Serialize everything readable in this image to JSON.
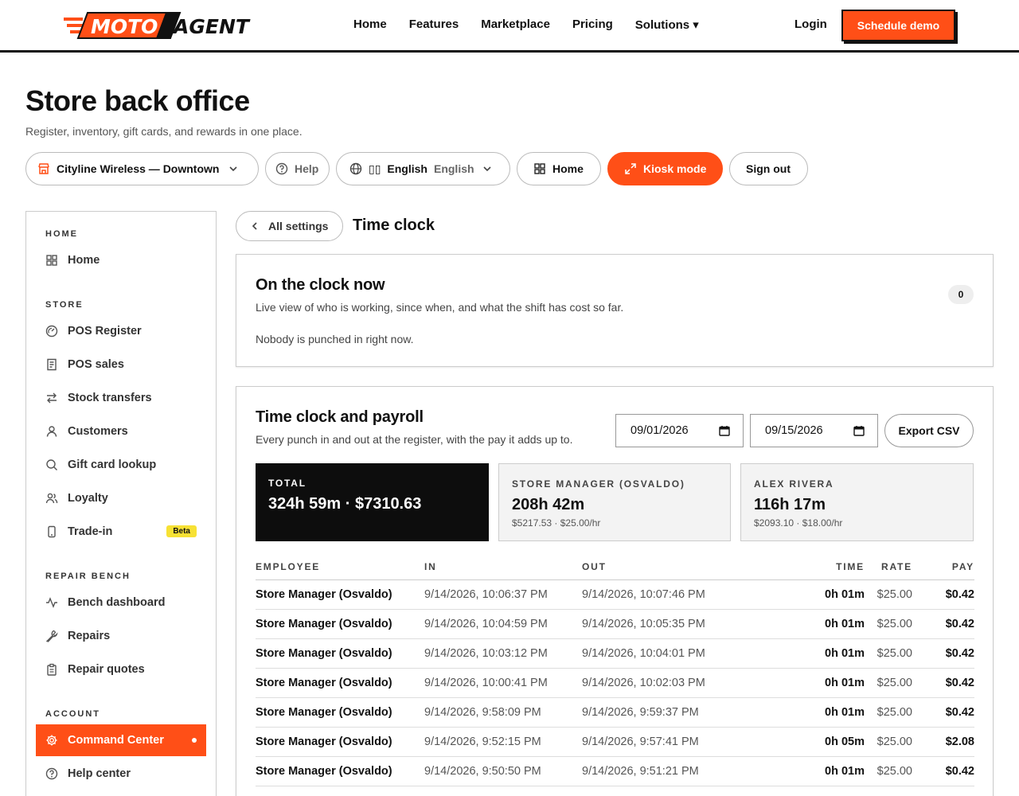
{
  "nav": {
    "brand_left": "MOTO",
    "brand_right": "AGENT",
    "links": [
      "Home",
      "Features",
      "Marketplace",
      "Pricing",
      "Solutions ▾"
    ],
    "login": "Login",
    "cta": "Schedule demo"
  },
  "header": {
    "title": "Store back office",
    "subtitle": "Register, inventory, gift cards, and rewards in one place."
  },
  "toolbar": {
    "store": "Cityline Wireless — Downtown",
    "help": "Help",
    "lang_flag": "▯▯",
    "lang_native": "English",
    "lang_en": "English",
    "home": "Home",
    "kiosk": "Kiosk mode",
    "signout": "Sign out"
  },
  "sidebar": {
    "sections": [
      "HOME",
      "STORE",
      "REPAIR BENCH",
      "ACCOUNT"
    ],
    "items": [
      {
        "label": "Home",
        "icon": "grid-icon"
      },
      {
        "label": "POS Register",
        "icon": "gauge-icon"
      },
      {
        "label": "POS sales",
        "icon": "receipt-icon"
      },
      {
        "label": "Stock transfers",
        "icon": "arrows-swap-icon"
      },
      {
        "label": "Customers",
        "icon": "user-icon"
      },
      {
        "label": "Gift card lookup",
        "icon": "search-icon"
      },
      {
        "label": "Loyalty",
        "icon": "users-icon"
      },
      {
        "label": "Trade-in",
        "icon": "phone-icon"
      },
      {
        "label": "Bench dashboard",
        "icon": "pulse-icon"
      },
      {
        "label": "Repairs",
        "icon": "wrench-icon"
      },
      {
        "label": "Repair quotes",
        "icon": "clipboard-icon"
      },
      {
        "label": "Command Center",
        "icon": "gear-icon"
      },
      {
        "label": "Help center",
        "icon": "help-circle-icon"
      }
    ],
    "beta": "Beta"
  },
  "main": {
    "back": "All settings",
    "title": "Time clock"
  },
  "on_clock": {
    "title": "On the clock now",
    "description": "Live view of who is working, since when, and what the shift has cost so far.",
    "empty": "Nobody is punched in right now.",
    "count": "0"
  },
  "payroll": {
    "title": "Time clock and payroll",
    "description": "Every punch in and out at the register, with the pay it adds up to.",
    "from_date": "09/01/2026",
    "to_date": "09/15/2026",
    "export": "Export CSV",
    "stats": [
      {
        "label": "TOTAL",
        "value": "324h 59m · $7310.63",
        "sub": ""
      },
      {
        "label": "STORE MANAGER (OSVALDO)",
        "value": "208h 42m",
        "sub": "$5217.53 · $25.00/hr"
      },
      {
        "label": "ALEX RIVERA",
        "value": "116h 17m",
        "sub": "$2093.10 · $18.00/hr"
      }
    ],
    "columns": [
      "EMPLOYEE",
      "IN",
      "OUT",
      "TIME",
      "RATE",
      "PAY"
    ],
    "rows": [
      [
        "Store Manager (Osvaldo)",
        "9/14/2026, 10:06:37 PM",
        "9/14/2026, 10:07:46 PM",
        "0h 01m",
        "$25.00",
        "$0.42"
      ],
      [
        "Store Manager (Osvaldo)",
        "9/14/2026, 10:04:59 PM",
        "9/14/2026, 10:05:35 PM",
        "0h 01m",
        "$25.00",
        "$0.42"
      ],
      [
        "Store Manager (Osvaldo)",
        "9/14/2026, 10:03:12 PM",
        "9/14/2026, 10:04:01 PM",
        "0h 01m",
        "$25.00",
        "$0.42"
      ],
      [
        "Store Manager (Osvaldo)",
        "9/14/2026, 10:00:41 PM",
        "9/14/2026, 10:02:03 PM",
        "0h 01m",
        "$25.00",
        "$0.42"
      ],
      [
        "Store Manager (Osvaldo)",
        "9/14/2026, 9:58:09 PM",
        "9/14/2026, 9:59:37 PM",
        "0h 01m",
        "$25.00",
        "$0.42"
      ],
      [
        "Store Manager (Osvaldo)",
        "9/14/2026, 9:52:15 PM",
        "9/14/2026, 9:57:41 PM",
        "0h 05m",
        "$25.00",
        "$2.08"
      ],
      [
        "Store Manager (Osvaldo)",
        "9/14/2026, 9:50:50 PM",
        "9/14/2026, 9:51:21 PM",
        "0h 01m",
        "$25.00",
        "$0.42"
      ]
    ]
  },
  "colors": {
    "accent": "#ff4f17",
    "dark": "#0d0d0d",
    "beta": "#f7e134"
  }
}
